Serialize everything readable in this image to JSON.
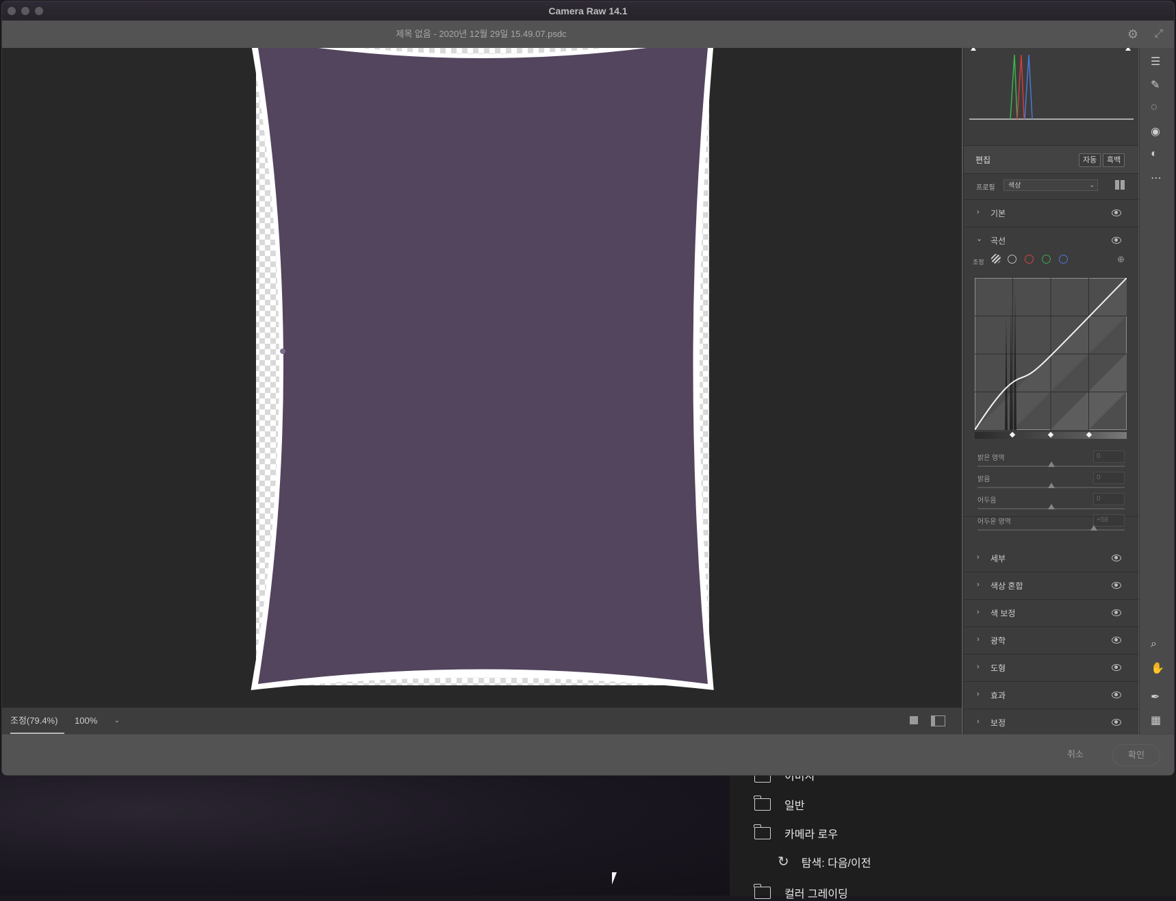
{
  "window": {
    "title": "Camera Raw 14.1",
    "file_name": "제목 없음 - 2020년 12월 29일 15.49.07.psdc"
  },
  "statusbar": {
    "fit_label": "조정(79.4%)",
    "zoom_value": "100%"
  },
  "panel": {
    "edit_label": "편집",
    "auto_label": "자동",
    "bw_label": "흑백",
    "profile_label": "프로필",
    "profile_value": "색상",
    "curve_adjust_label": "조정",
    "sections_top": [
      {
        "label": "기본",
        "expanded": false
      },
      {
        "label": "곡선",
        "expanded": true
      }
    ],
    "curve_sliders": [
      {
        "label": "밝은 영역",
        "value": "0",
        "position": 0.5
      },
      {
        "label": "밝음",
        "value": "0",
        "position": 0.5
      },
      {
        "label": "어두움",
        "value": "0",
        "position": 0.5
      },
      {
        "label": "어두운 영역",
        "value": "+58",
        "position": 0.79
      }
    ],
    "sections_bottom": [
      {
        "label": "세부"
      },
      {
        "label": "색상 혼합"
      },
      {
        "label": "색 보정"
      },
      {
        "label": "광학"
      },
      {
        "label": "도형"
      },
      {
        "label": "효과"
      },
      {
        "label": "보정"
      }
    ]
  },
  "footer": {
    "cancel_label": "취소",
    "ok_label": "확인"
  },
  "background_menu": {
    "items": [
      {
        "label": "이미지",
        "icon": "folder-icon"
      },
      {
        "label": "일반",
        "icon": "folder-icon"
      },
      {
        "label": "카메라 로우",
        "icon": "folder-icon"
      },
      {
        "label": "탐색: 다음/이전",
        "icon": "rotate-icon"
      },
      {
        "label": "컬러 그레이딩",
        "icon": "folder-icon"
      }
    ]
  },
  "colors": {
    "image_fill": "#53455e",
    "canvas_bg": "#282828",
    "panel_bg": "#3c3c3c"
  }
}
